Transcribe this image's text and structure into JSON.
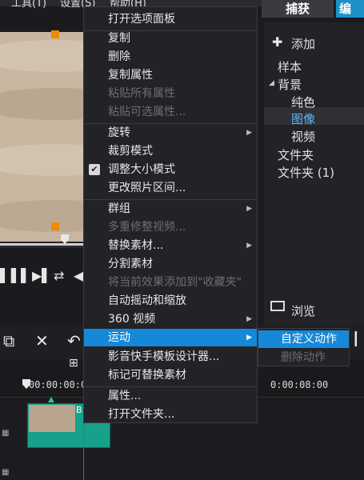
{
  "menubar": {
    "tools": "工具(T)",
    "settings": "设置(S)",
    "help": "帮助(H)"
  },
  "right_panel": {
    "tab_capture": "捕获",
    "tab_edit": "编",
    "add_label": "添加",
    "items": {
      "sample": "样本",
      "background": "背景",
      "solid": "纯色",
      "image": "图像",
      "video": "视频",
      "folder": "文件夹",
      "folder1": "文件夹 (1)"
    },
    "browse_label": "浏览"
  },
  "timeline": {
    "tc_start": "00:00:00:00",
    "tc_end": "0:00:08:00",
    "clip_label": "B"
  },
  "context_menu": {
    "open_options": "打开选项面板",
    "copy": "复制",
    "delete": "删除",
    "copy_attrs": "复制属性",
    "paste_all_attrs": "粘贴所有属性",
    "paste_selectable_attrs": "粘贴可选属性...",
    "rotate": "旋转",
    "crop_mode": "裁剪模式",
    "resize_mode": "调整大小模式",
    "change_photo_duration": "更改照片区间...",
    "group": "群组",
    "multi_trim": "多重修整视频...",
    "replace_clip": "替换素材...",
    "split_clip": "分割素材",
    "add_effect_favorites": "将当前效果添加到\"收藏夹\"",
    "auto_pan_zoom": "自动摇动和缩放",
    "video_360": "360 视频",
    "motion": "运动",
    "fastflick_designer": "影音快手模板设计器...",
    "mark_replaceable": "标记可替换素材",
    "properties": "属性...",
    "open_folder": "打开文件夹..."
  },
  "submenu": {
    "custom_motion": "自定义动作",
    "delete_motion": "删除动作"
  },
  "colors": {
    "highlight": "#1688d8",
    "accent_orange": "#f08a00",
    "clip_teal": "#17a08a"
  }
}
